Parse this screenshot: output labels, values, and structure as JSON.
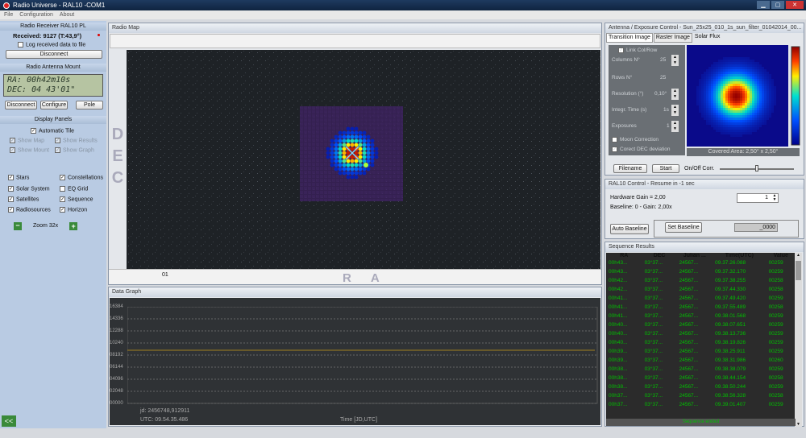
{
  "window": {
    "title": "Radio Universe - RAL10 -COM1"
  },
  "menu": [
    "File",
    "Configuration",
    "About"
  ],
  "receiver": {
    "header": "Radio Receiver RAL10 PL",
    "received": "Received: 9127 (T:43,9°)",
    "log_label": "Log received data to file",
    "disconnect": "Disconnect"
  },
  "mount": {
    "header": "Radio Antenna Mount",
    "ra": "RA: 00h42m10s",
    "dec": "DEC: 04 43'01\"",
    "disconnect": "Disconnect",
    "configure": "Configure",
    "pole": "Pole"
  },
  "display": {
    "header": "Display Panels",
    "automatic_tile": "Automatic Tile",
    "show_map": "Show Map",
    "show_results": "Show Results",
    "show_mount": "Show Mount",
    "show_graph": "Show Graph",
    "options": [
      "Stars",
      "Constellations",
      "Solar System",
      "EQ Grid",
      "Satellites",
      "Sequence",
      "Radiosources",
      "Horizon"
    ],
    "checked": [
      true,
      true,
      true,
      false,
      true,
      true,
      true,
      true
    ],
    "zoom": "Zoom 32x",
    "zoom_minus": "−",
    "zoom_plus": "+",
    "collapse": "<<"
  },
  "map": {
    "title": "Radio Map",
    "axis_dec": [
      "D",
      "E",
      "C"
    ],
    "axis_ra": [
      "R",
      "A"
    ],
    "ra_tick": "01"
  },
  "graph": {
    "title": "Data Graph",
    "yticks": [
      "16384",
      "14336",
      "12288",
      "10240",
      "08192",
      "06144",
      "04096",
      "02048",
      "00000"
    ],
    "jd": "jd: 2456748,912911",
    "utc": "UTC: 09.54.35.486",
    "xlabel": "Time [JD,UTC]"
  },
  "antenna": {
    "title": "Antenna / Exposure Control - Sun_25x25_010_1s_sun_filter_01042014_00...",
    "tabs": [
      "Transition Image",
      "Raster Image",
      "Solar Flux"
    ],
    "link": "Link Col/Row",
    "columns_label": "Columns N°",
    "columns": "25",
    "rows_label": "Rows N°",
    "rows": "25",
    "res_label": "Resolution (°)",
    "res": "0,10°",
    "time_label": "Integr. Time (s)",
    "time": "1s",
    "exp_label": "Exposures",
    "exp": "1",
    "moon": "Moon Correction",
    "dec_corr": "Corect DEC deviation",
    "covered": "Covered Area: 2,50° x 2,50°",
    "filename": "Filename",
    "start": "Start",
    "onoff": "On/Off Corr."
  },
  "ral10": {
    "title": "RAL10 Control - Resume in -1 sec",
    "gain": "Hardware Gain = 2,00",
    "baseline": "Baseline: 0 - Gain: 2,00x",
    "gain_value": "1",
    "auto": "Auto Baseline",
    "set": "Set Baseline",
    "base_value": "_0000"
  },
  "sequence": {
    "title": "Sequence Results",
    "headers": [
      "RA",
      "DEC",
      "Julian ...",
      "Time(UTC)",
      "Value"
    ],
    "rows": [
      [
        "00h43...",
        "03°37...",
        "24567...",
        "09.37.26.088",
        "00259"
      ],
      [
        "00h43...",
        "03°37...",
        "24567...",
        "09.37.32.170",
        "00259"
      ],
      [
        "00h42...",
        "03°37...",
        "24567...",
        "09.37.38.255",
        "00258"
      ],
      [
        "00h42...",
        "03°37...",
        "24567...",
        "09.37.44.330",
        "00258"
      ],
      [
        "00h41...",
        "03°37...",
        "24567...",
        "09.37.49.420",
        "00259"
      ],
      [
        "00h41...",
        "03°37...",
        "24567...",
        "09.37.55.489",
        "00258"
      ],
      [
        "00h41...",
        "03°37...",
        "24567...",
        "09.38.01.568",
        "00259"
      ],
      [
        "00h40...",
        "03°37...",
        "24567...",
        "09.38.07.651",
        "00259"
      ],
      [
        "00h40...",
        "03°37...",
        "24567...",
        "09.38.13.736",
        "00259"
      ],
      [
        "00h40...",
        "03°37...",
        "24567...",
        "09.38.19.826",
        "00259"
      ],
      [
        "00h39...",
        "03°37...",
        "24567...",
        "09.38.25.911",
        "00259"
      ],
      [
        "00h39...",
        "03°37...",
        "24567...",
        "09.38.31.986",
        "00260"
      ],
      [
        "00h38...",
        "03°37...",
        "24567...",
        "09.38.38.079",
        "00259"
      ],
      [
        "00h38...",
        "03°37...",
        "24567...",
        "09.38.44.154",
        "00258"
      ],
      [
        "00h38...",
        "03°37...",
        "24567...",
        "09.38.50.244",
        "00259"
      ],
      [
        "00h37...",
        "03°37...",
        "24567...",
        "09.38.56.328",
        "00258"
      ],
      [
        "00h37...",
        "03°37...",
        "24567...",
        "09.39.01.407",
        "00259"
      ]
    ],
    "footer": "Sequence ended"
  }
}
